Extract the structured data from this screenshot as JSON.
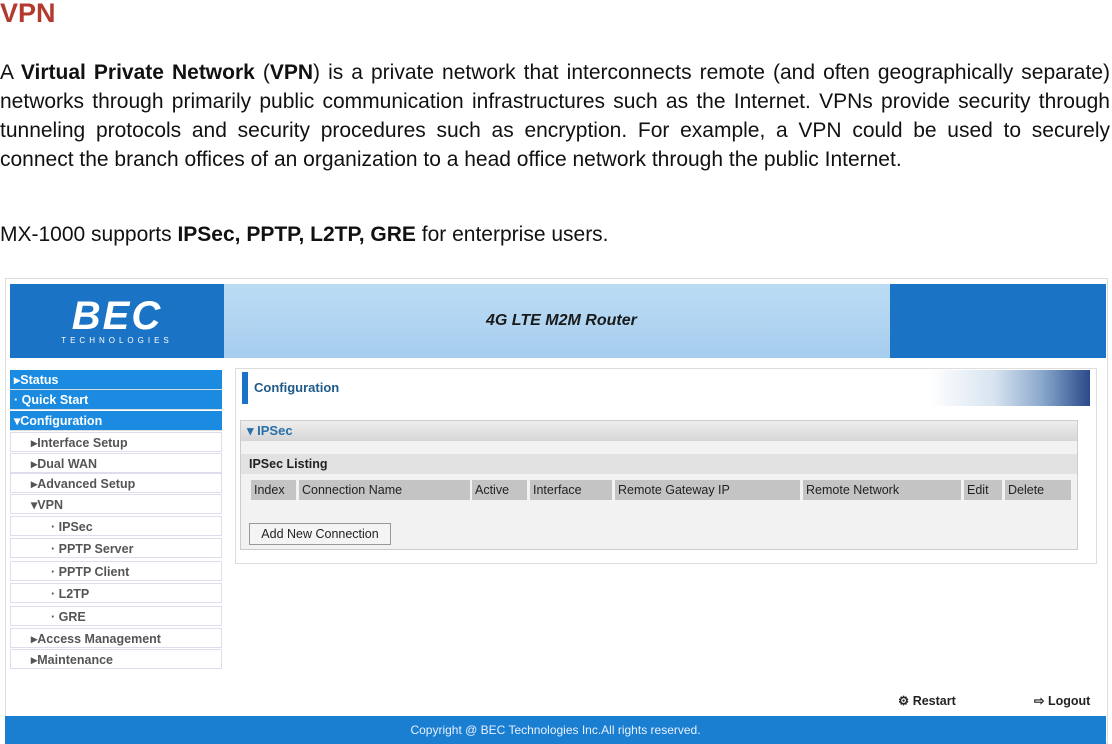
{
  "heading": "VPN",
  "p1": {
    "a": "A ",
    "b1": "Virtual Private Network",
    "c": " (",
    "b2": "VPN",
    "d": ") is a private network that interconnects remote (and often geographically separate) networks through primarily public communication infrastructures such as the Internet. VPNs provide security through tunneling protocols and security procedures such as encryption. For example, a VPN could be used to securely connect the branch offices of an organization to a head office network through the public Internet."
  },
  "p2": {
    "a": "MX-1000 supports ",
    "b": "IPSec, PPTP, L2TP, GRE",
    "c": " for enterprise users."
  },
  "router": {
    "logo": "BEC",
    "logo_sub": "TECHNOLOGIES",
    "banner": "4G LTE M2M Router",
    "sidebar": [
      "▸Status",
      "· Quick Start",
      "▾Configuration",
      "▸Interface Setup",
      "▸Dual WAN",
      "▸Advanced Setup",
      "▾VPN",
      "· IPSec",
      "· PPTP Server",
      "· PPTP Client",
      "· L2TP",
      "· GRE",
      "▸Access Management",
      "▸Maintenance"
    ],
    "page_title": "Configuration",
    "section": "▾ IPSec",
    "listing": "IPSec Listing",
    "columns": [
      "Index",
      "Connection Name",
      "Active",
      "Interface",
      "Remote Gateway IP",
      "Remote Network",
      "Edit",
      "Delete"
    ],
    "add_button": "Add New Connection",
    "restart": "Restart",
    "logout": "Logout",
    "copyright": "Copyright @ BEC Technologies Inc.All rights reserved.",
    "accent": "#1a73c4"
  }
}
